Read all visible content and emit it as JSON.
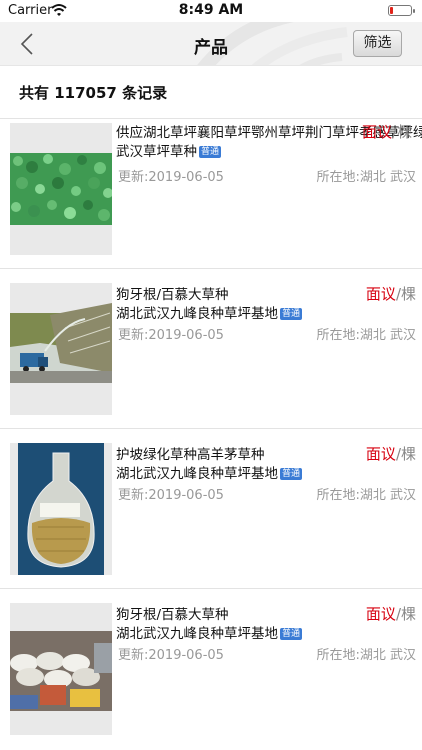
{
  "status_bar": {
    "carrier": "Carrier",
    "time": "8:49 AM",
    "battery_level": 0.15
  },
  "nav": {
    "title": "产品",
    "filter_label": "筛选"
  },
  "summary": {
    "record_text": "共有 117057 条记录"
  },
  "colors": {
    "price": "#d7000f",
    "muted": "#999999",
    "badge": "#3a7bd5"
  },
  "items": [
    {
      "title_line1": "供应湖北草坪襄阳草坪鄂州草坪荆门草坪孝感草坪绿",
      "title_line2": "武汉草坪草种",
      "badge": "普通",
      "price": "面议",
      "unit": "/棵",
      "updated": "更新:2019-06-05",
      "location": "所在地:湖北 武汉"
    },
    {
      "title_line1": "狗牙根/百慕大草种",
      "title_line2": "湖北武汉九峰良种草坪基地",
      "badge": "普通",
      "price": "面议",
      "unit": "/棵",
      "updated": "更新:2019-06-05",
      "location": "所在地:湖北 武汉"
    },
    {
      "title_line1": "护坡绿化草种高羊茅草种",
      "title_line2": "湖北武汉九峰良种草坪基地",
      "badge": "普通",
      "price": "面议",
      "unit": "/棵",
      "updated": "更新:2019-06-05",
      "location": "所在地:湖北 武汉"
    },
    {
      "title_line1": "狗牙根/百慕大草种",
      "title_line2": "湖北武汉九峰良种草坪基地",
      "badge": "普通",
      "price": "面议",
      "unit": "/棵",
      "updated": "更新:2019-06-05",
      "location": "所在地:湖北 武汉"
    }
  ]
}
